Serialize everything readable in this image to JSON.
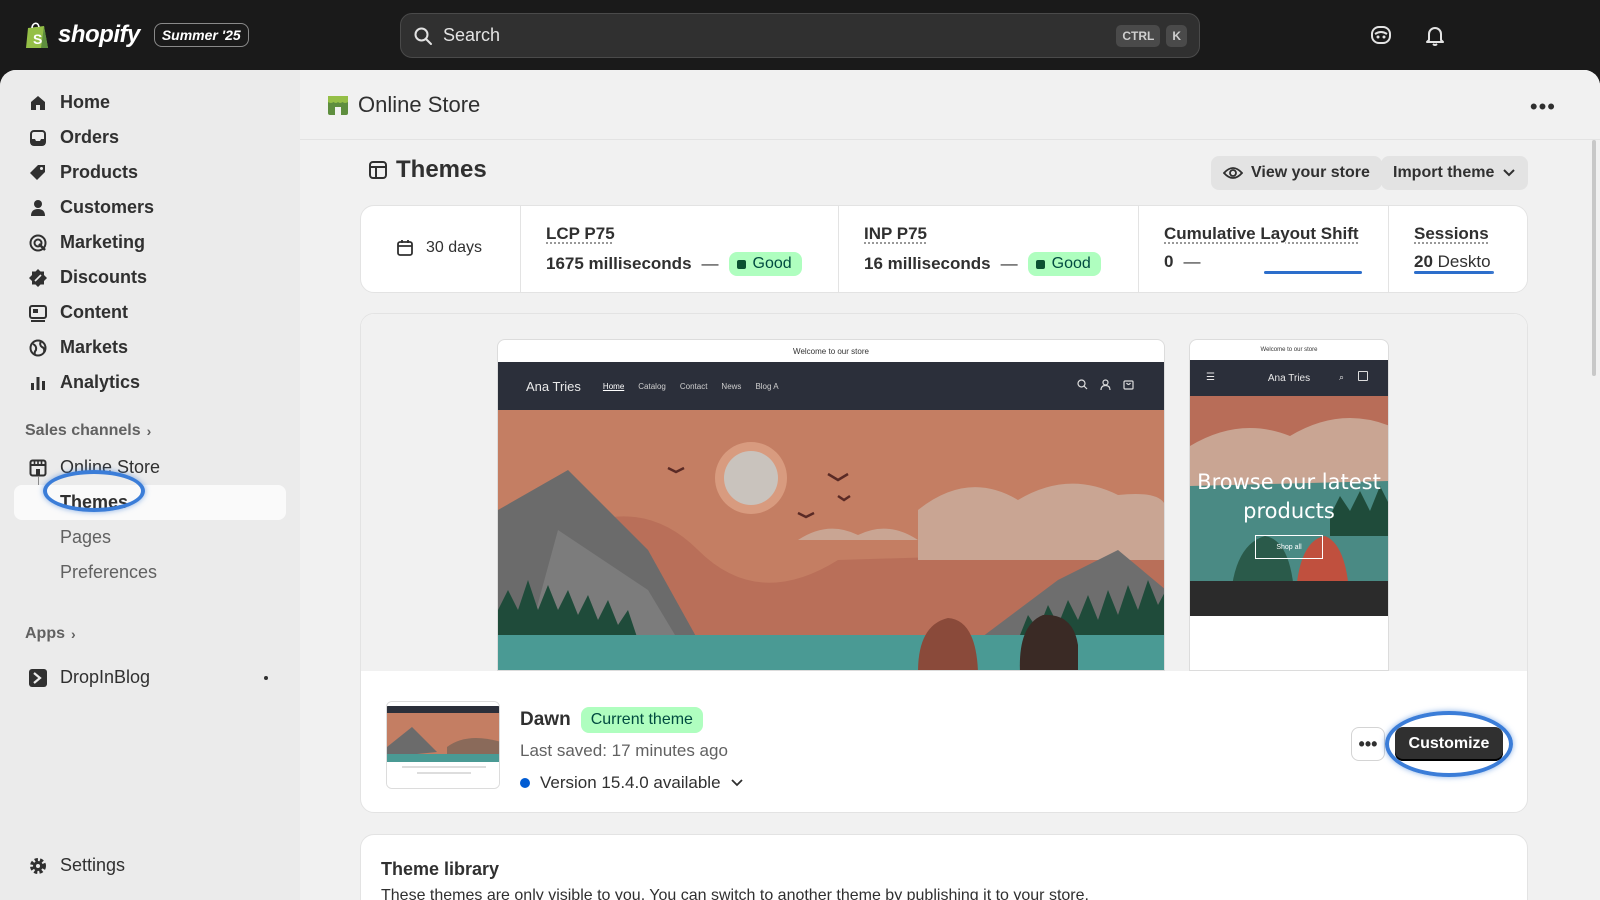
{
  "topbar": {
    "brand": "shopify",
    "edition": "Summer '25",
    "search": {
      "placeholder": "Search",
      "shortcut_1": "CTRL",
      "shortcut_2": "K"
    },
    "icons": [
      "sidekick-icon",
      "bell-icon"
    ]
  },
  "sidebar": {
    "items": [
      {
        "label": "Home",
        "icon": "home-icon"
      },
      {
        "label": "Orders",
        "icon": "orders-icon"
      },
      {
        "label": "Products",
        "icon": "tag-icon"
      },
      {
        "label": "Customers",
        "icon": "person-icon"
      },
      {
        "label": "Marketing",
        "icon": "target-icon"
      },
      {
        "label": "Discounts",
        "icon": "discount-icon"
      },
      {
        "label": "Content",
        "icon": "content-icon"
      },
      {
        "label": "Markets",
        "icon": "globe-icon"
      },
      {
        "label": "Analytics",
        "icon": "bar-chart-icon"
      }
    ],
    "sales_channels": "Sales channels",
    "online_store": "Online Store",
    "sub_items": [
      "Themes",
      "Pages",
      "Preferences"
    ],
    "apps": "Apps",
    "app_item": "DropInBlog",
    "settings": "Settings"
  },
  "page": {
    "title": "Online Store",
    "section_title": "Themes",
    "view_store": "View your store",
    "import_theme": "Import theme"
  },
  "metrics": {
    "period": "30 days",
    "lcp": {
      "label": "LCP P75",
      "value": "1675 milliseconds",
      "sep": "—",
      "status": "Good"
    },
    "inp": {
      "label": "INP P75",
      "value": "16 milliseconds",
      "sep": "—",
      "status": "Good"
    },
    "cls": {
      "label": "Cumulative Layout Shift",
      "value": "0",
      "sep": "—"
    },
    "sessions": {
      "label": "Sessions",
      "value": "20",
      "sub": "Deskto"
    }
  },
  "preview": {
    "announcement": "Welcome to our store",
    "store_name": "Ana Tries",
    "nav_links": [
      "Home",
      "Catalog",
      "Contact",
      "News",
      "Blog A"
    ],
    "mobile_hero": "Browse our latest products",
    "shop_all": "Shop all"
  },
  "theme": {
    "name": "Dawn",
    "badge": "Current theme",
    "last_saved": "Last saved: 17 minutes ago",
    "version": "Version 15.4.0 available",
    "more": "•••",
    "customize": "Customize"
  },
  "library": {
    "title": "Theme library",
    "description": "These themes are only visible to you. You can switch to another theme by publishing it to your store."
  },
  "colors": {
    "accent": "#3b7dd8",
    "good_bg": "#affebf",
    "dark": "#303030"
  }
}
